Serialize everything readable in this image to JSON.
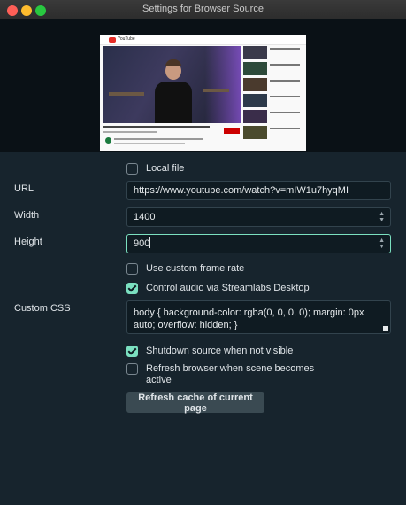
{
  "window": {
    "title": "Settings for Browser Source"
  },
  "preview": {
    "site_logo_text": "YouTube"
  },
  "local_file": {
    "label": "Local file",
    "checked": false
  },
  "url": {
    "label": "URL",
    "value": "https://www.youtube.com/watch?v=mIW1u7hyqMI"
  },
  "width": {
    "label": "Width",
    "value": "1400"
  },
  "height": {
    "label": "Height",
    "value": "900"
  },
  "custom_frame_rate": {
    "label": "Use custom frame rate",
    "checked": false
  },
  "control_audio": {
    "label": "Control audio via Streamlabs Desktop",
    "checked": true
  },
  "custom_css": {
    "label": "Custom CSS",
    "value": "body { background-color: rgba(0, 0, 0, 0); margin: 0px auto; overflow: hidden; }"
  },
  "shutdown": {
    "label": "Shutdown source when not visible",
    "checked": true
  },
  "refresh_active": {
    "label": "Refresh browser when scene becomes active",
    "checked": false
  },
  "refresh_button": {
    "label": "Refresh cache of current page"
  },
  "colors": {
    "accent": "#7be0c0",
    "background": "#17242d",
    "input_bg": "#0f1b22"
  }
}
